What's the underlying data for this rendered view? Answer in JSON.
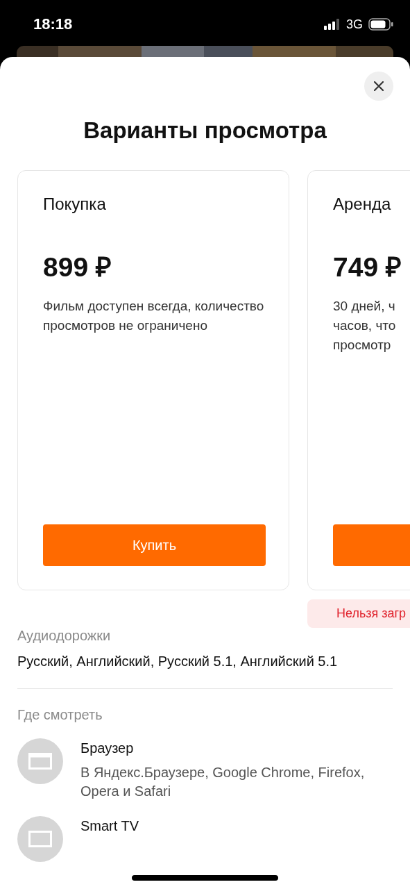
{
  "status_bar": {
    "time": "18:18",
    "network": "3G"
  },
  "sheet": {
    "title": "Варианты просмотра"
  },
  "offers": [
    {
      "name": "Покупка",
      "price": "899 ₽",
      "description": "Фильм доступен всегда, количество просмотров не ограничено",
      "button": "Купить"
    },
    {
      "name": "Аренда",
      "price": "749 ₽",
      "description": "30 дней, ч\nчасов, что\nпросмотр",
      "notice": "Нельзя загр"
    }
  ],
  "audio": {
    "heading": "Аудиодорожки",
    "text": "Русский, Английский, Русский 5.1, Английский 5.1"
  },
  "where": {
    "heading": "Где смотреть",
    "items": [
      {
        "kind": "browser",
        "title": "Браузер",
        "description": "В Яндекс.Браузере, Google Chrome, Firefox, Opera и Safari"
      },
      {
        "kind": "tv",
        "title": "Smart TV"
      }
    ]
  }
}
